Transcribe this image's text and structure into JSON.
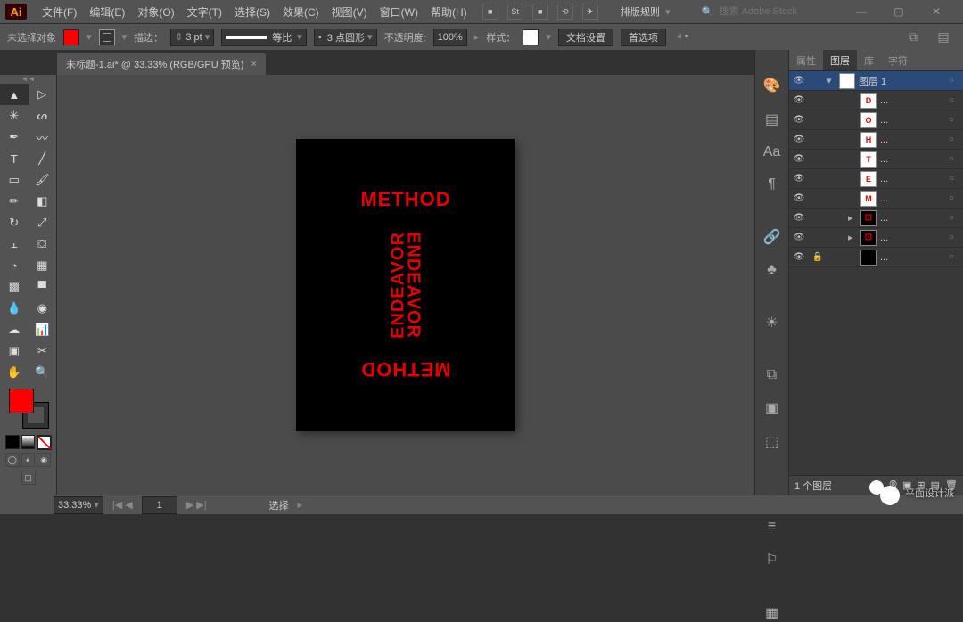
{
  "app": "Ai",
  "menus": [
    "文件(F)",
    "编辑(E)",
    "对象(O)",
    "文字(T)",
    "选择(S)",
    "效果(C)",
    "视图(V)",
    "窗口(W)",
    "帮助(H)"
  ],
  "menubar_extras": [
    "■",
    "St",
    "■",
    "⟲",
    "✈"
  ],
  "arrange_label": "排版规则",
  "search_placeholder": "搜索 Adobe Stock",
  "control": {
    "selection": "未选择对象",
    "stroke_label": "描边：",
    "stroke_w": "3 pt",
    "dash_label": "等比",
    "brush_label": "3 点圆形",
    "opacity_label": "不透明度:",
    "opacity": "100%",
    "style_label": "样式：",
    "doc_setup": "文档设置",
    "prefs": "首选项"
  },
  "tab_title": "未标题-1.ai* @ 33.33% (RGB/GPU 预览)",
  "artwork": {
    "top": "METHOD",
    "bottom": "METHOD",
    "left": "ENDEAVOR",
    "right": "ENDEAVOR"
  },
  "panel_tabs": [
    "属性",
    "图层",
    "库",
    "字符"
  ],
  "panel_active": 1,
  "layers": [
    {
      "d": 0,
      "thumb": "blank",
      "name": "图层 1",
      "arrow": "▾",
      "expand": "▸"
    },
    {
      "d": 2,
      "thumb": "D",
      "name": "..."
    },
    {
      "d": 2,
      "thumb": "O",
      "name": "..."
    },
    {
      "d": 2,
      "thumb": "H",
      "name": "..."
    },
    {
      "d": 2,
      "thumb": "T",
      "name": "..."
    },
    {
      "d": 2,
      "thumb": "E",
      "name": "..."
    },
    {
      "d": 2,
      "thumb": "M",
      "name": "..."
    },
    {
      "d": 2,
      "thumb": "grp",
      "name": "...",
      "arrow": "▸"
    },
    {
      "d": 2,
      "thumb": "grp",
      "name": "...",
      "arrow": "▸"
    },
    {
      "d": 2,
      "thumb": "blk",
      "name": "...",
      "locked": true
    }
  ],
  "layer_count": "1 个图层",
  "status": {
    "zoom": "33.33%",
    "nav": "1",
    "mode": "选择"
  },
  "watermark": "平面设计派"
}
